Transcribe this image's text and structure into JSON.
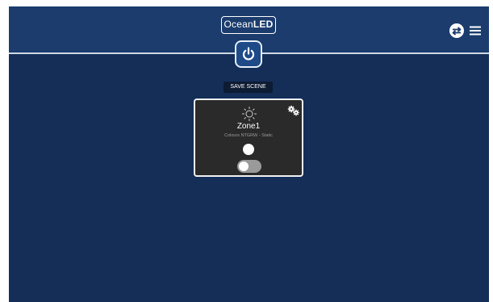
{
  "header": {
    "logo_light": "Ocean",
    "logo_bold": "LED",
    "power_icon": "power-icon",
    "sync_icon": "sync-icon",
    "menu_icon": "hamburger-menu-icon"
  },
  "scene": {
    "save_label": "SAVE SCENE"
  },
  "zones": [
    {
      "icon": "sun-icon",
      "settings_icon": "gears-icon",
      "name": "Zone1",
      "subtitle": "Colours NTGRW - Static",
      "color": "#ffffff",
      "on": false
    }
  ],
  "colors": {
    "background": "#142e58",
    "header": "#1b3c6d",
    "card": "#2a2a2a",
    "accent": "#1e4a88"
  }
}
